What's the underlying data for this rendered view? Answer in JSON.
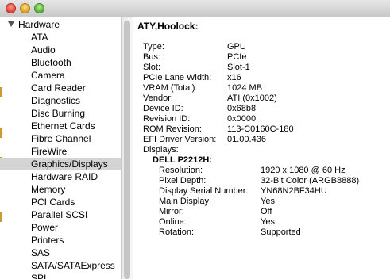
{
  "sidebar": {
    "group_label": "Hardware",
    "items": [
      {
        "label": "ATA"
      },
      {
        "label": "Audio"
      },
      {
        "label": "Bluetooth"
      },
      {
        "label": "Camera"
      },
      {
        "label": "Card Reader"
      },
      {
        "label": "Diagnostics"
      },
      {
        "label": "Disc Burning"
      },
      {
        "label": "Ethernet Cards"
      },
      {
        "label": "Fibre Channel"
      },
      {
        "label": "FireWire"
      },
      {
        "label": "Graphics/Displays",
        "selected": true
      },
      {
        "label": "Hardware RAID"
      },
      {
        "label": "Memory"
      },
      {
        "label": "PCI Cards"
      },
      {
        "label": "Parallel SCSI"
      },
      {
        "label": "Power"
      },
      {
        "label": "Printers"
      },
      {
        "label": "SAS"
      },
      {
        "label": "SATA/SATAExpress"
      },
      {
        "label": "SPI"
      }
    ]
  },
  "detail": {
    "title": "ATY,Hoolock:",
    "properties": [
      {
        "key": "Type:",
        "value": "GPU"
      },
      {
        "key": "Bus:",
        "value": "PCIe"
      },
      {
        "key": "Slot:",
        "value": "Slot-1"
      },
      {
        "key": "PCIe Lane Width:",
        "value": "x16"
      },
      {
        "key": "VRAM (Total):",
        "value": "1024 MB"
      },
      {
        "key": "Vendor:",
        "value": "ATI (0x1002)"
      },
      {
        "key": "Device ID:",
        "value": "0x68b8"
      },
      {
        "key": "Revision ID:",
        "value": "0x0000"
      },
      {
        "key": "ROM Revision:",
        "value": "113-C0160C-180"
      },
      {
        "key": "EFI Driver Version:",
        "value": "01.00.436"
      }
    ],
    "displays_label": "Displays:",
    "display_name": "DELL P2212H:",
    "display_properties": [
      {
        "key": "Resolution:",
        "value": "1920 x 1080 @ 60 Hz"
      },
      {
        "key": "Pixel Depth:",
        "value": "32-Bit Color (ARGB8888)"
      },
      {
        "key": "Display Serial Number:",
        "value": "YN68N2BF34HU"
      },
      {
        "key": "Main Display:",
        "value": "Yes"
      },
      {
        "key": "Mirror:",
        "value": "Off"
      },
      {
        "key": "Online:",
        "value": "Yes"
      },
      {
        "key": "Rotation:",
        "value": "Supported"
      }
    ]
  }
}
